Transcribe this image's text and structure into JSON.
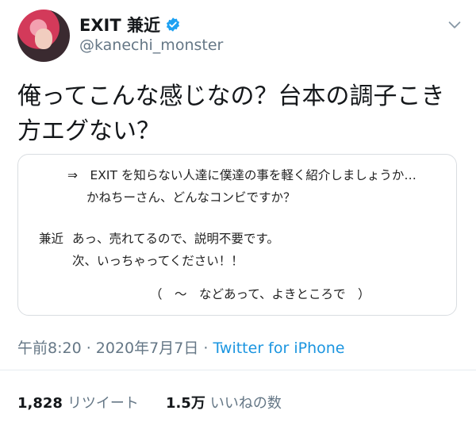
{
  "user": {
    "display_name": "EXIT 兼近",
    "handle": "@kanechi_monster",
    "verified_color": "#1da1f2"
  },
  "tweet": {
    "line1": "俺ってこんな感じなの？台本の調子こき",
    "line2": "方エグない？"
  },
  "quote": {
    "line1": "⇒　EXIT を知らない人達に僕達の事を軽く紹介しましょうか…",
    "line2": "かねちーさん、どんなコンビですか？",
    "speaker": "兼近",
    "line3": "あっ、売れてるので、説明不要です。",
    "line4": "次、いっちゃってください！！",
    "line5": "（　～　などあって、よきところで　）"
  },
  "meta": {
    "time": "午前8:20",
    "sep1": " · ",
    "date": "2020年7月7日",
    "sep2": " · ",
    "source": "Twitter for iPhone"
  },
  "stats": {
    "retweets": "1,828",
    "retweets_label": "リツイート",
    "likes": "1.5万",
    "likes_label": "いいねの数"
  },
  "icons": {
    "verified": "verified-badge-icon",
    "menu": "chevron-down-icon"
  }
}
